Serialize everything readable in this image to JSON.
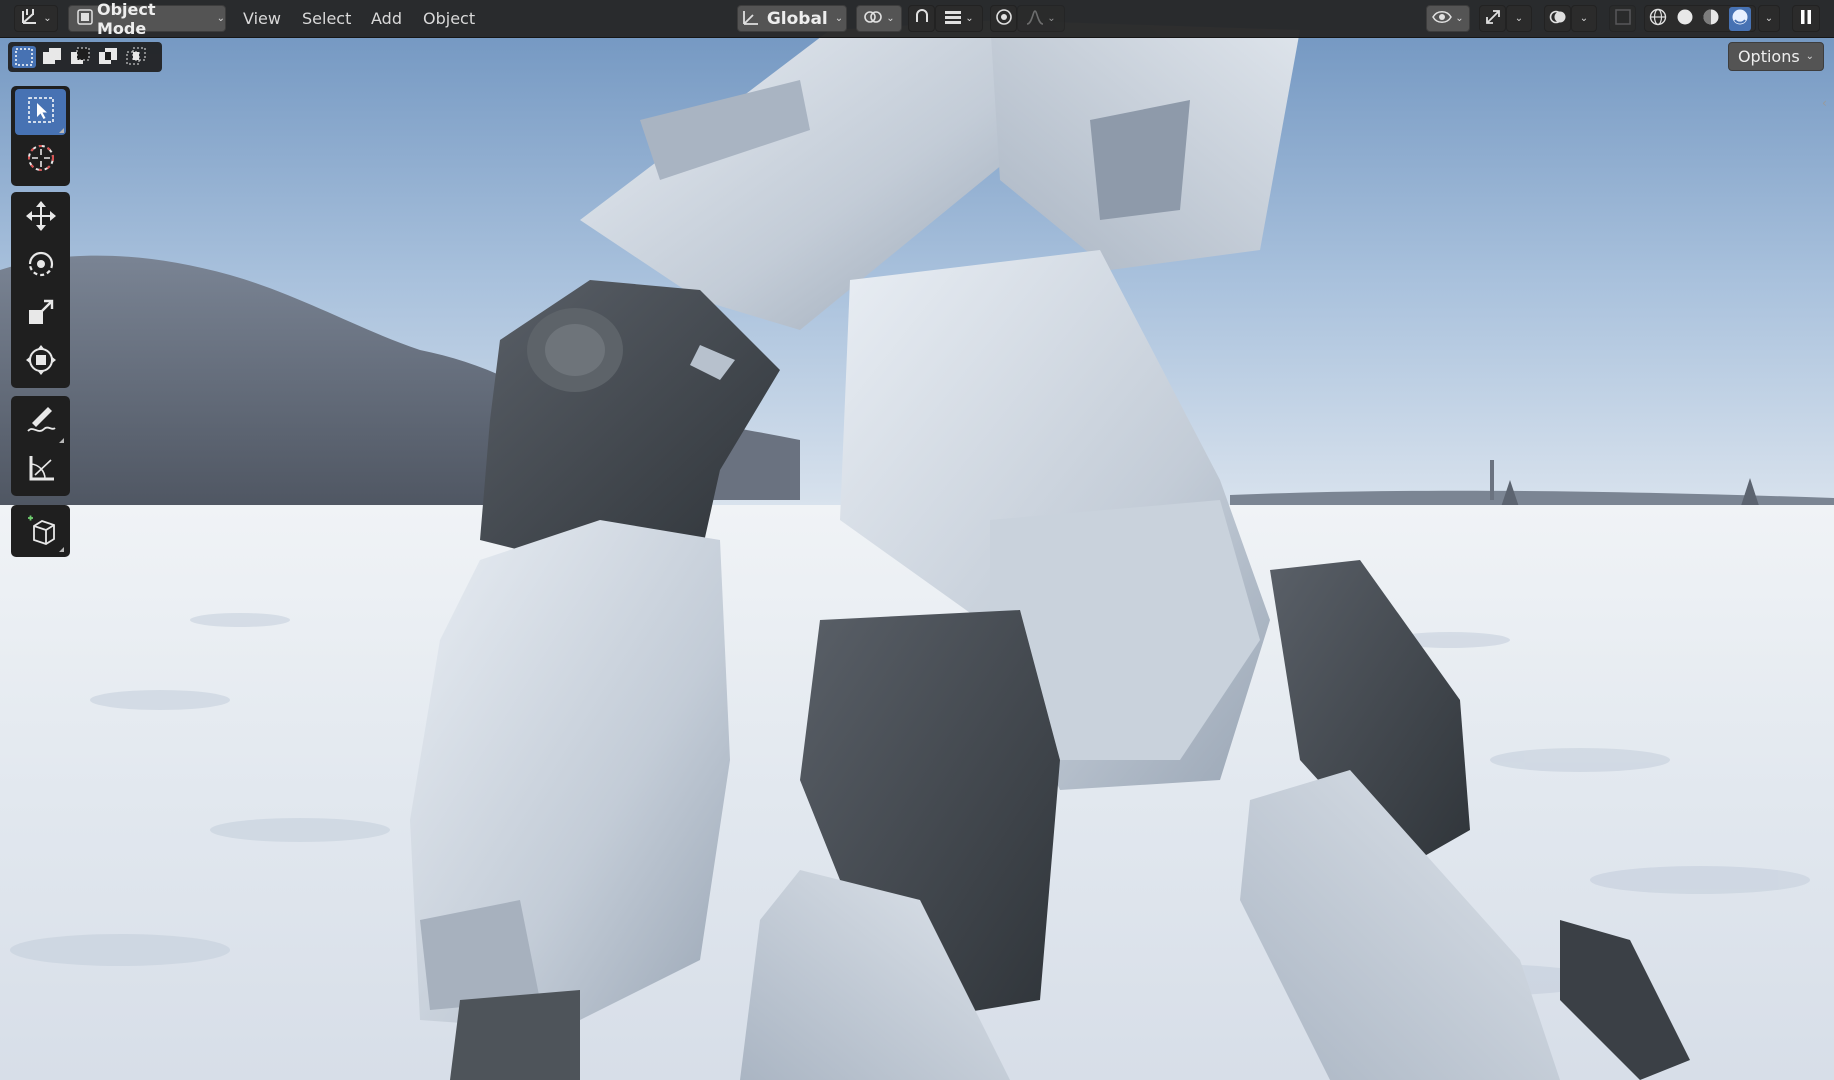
{
  "app": {
    "editor_type_icon": "3d-viewport-icon"
  },
  "header": {
    "mode_selector": {
      "label": "Object Mode",
      "icon": "object-mode-icon"
    },
    "menus": [
      {
        "label": "View"
      },
      {
        "label": "Select"
      },
      {
        "label": "Add"
      },
      {
        "label": "Object"
      }
    ],
    "transform_orientation": {
      "label": "Global",
      "icon": "transform-orientation-icon"
    },
    "right_icons": [
      "pivot-point-icon",
      "snap-icon",
      "snap-increment-icon",
      "proportional-editing-icon",
      "proportional-falloff-icon",
      "visibility-icon",
      "gizmo-icon",
      "overlay-icon",
      "xray-icon",
      "wireframe-shading-icon",
      "solid-shading-icon",
      "material-preview-icon",
      "rendered-shading-icon"
    ],
    "active_shading": "rendered",
    "accent_color": "#4772b3"
  },
  "select_mode": {
    "modes": [
      "select-new-icon",
      "select-extend-icon",
      "select-subtract-icon",
      "select-difference-icon",
      "select-intersect-icon"
    ],
    "active": "select-new-icon"
  },
  "options_button": {
    "label": "Options"
  },
  "toolbar": {
    "tools": [
      {
        "name": "select-box-icon",
        "active": true
      },
      {
        "name": "cursor-icon",
        "active": false
      },
      {
        "name": "move-icon",
        "active": false
      },
      {
        "name": "rotate-icon",
        "active": false
      },
      {
        "name": "scale-icon",
        "active": false
      },
      {
        "name": "transform-icon",
        "active": false
      },
      {
        "name": "annotate-icon",
        "active": false
      },
      {
        "name": "measure-icon",
        "active": false
      },
      {
        "name": "add-cube-icon",
        "active": false
      }
    ]
  },
  "viewport": {
    "content": "rendered-scene",
    "sky_color": "#aac2dd",
    "snow_color": "#e8edf2"
  }
}
